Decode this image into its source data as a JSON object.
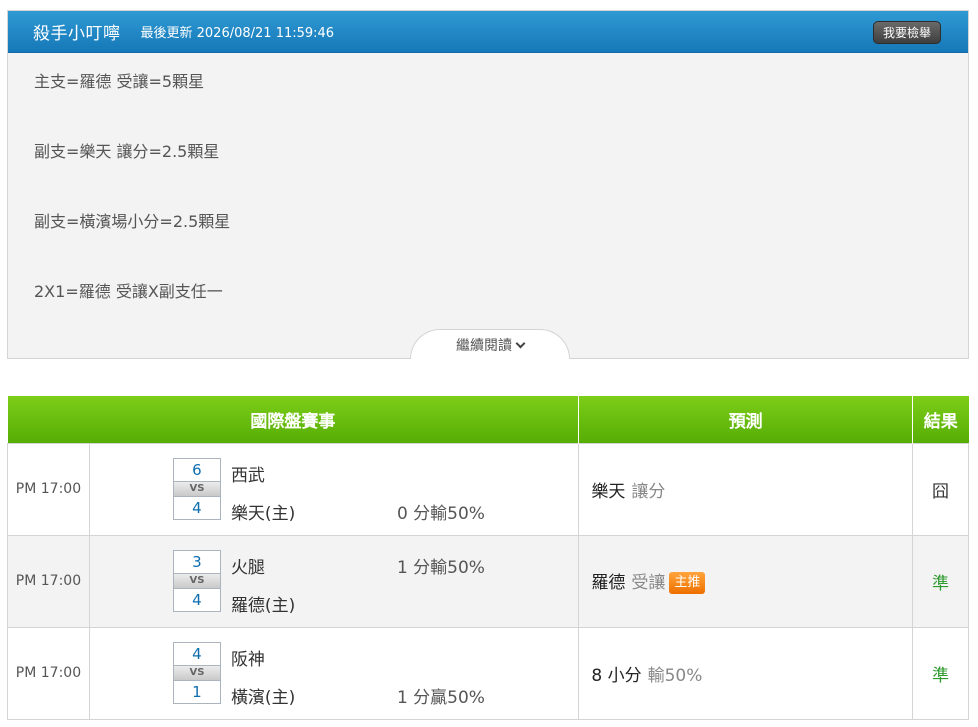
{
  "header": {
    "title": "殺手小叮嚀",
    "updated": "最後更新 2026/08/21 11:59:46",
    "report_label": "我要檢舉",
    "bg_color": "#1e86c6"
  },
  "picks": [
    "主支=羅德 受讓=5顆星",
    "副支=樂天 讓分=2.5顆星",
    "副支=橫濱場小分=2.5顆星",
    "2X1=羅德 受讓X副支任一"
  ],
  "more_label": "繼續閱讀",
  "table": {
    "header_color": "#66bb0e",
    "headers": {
      "match": "國際盤賽事",
      "predict": "預測",
      "result": "結果"
    },
    "rows": [
      {
        "time": "PM 17:00",
        "score_top": "6",
        "score_bottom": "4",
        "vs": "VS",
        "team_top": "西武",
        "team_bottom": "樂天(主)",
        "line_top": "",
        "line_bottom": "0 分輸50%",
        "pred_team": "樂天",
        "pred_type": "讓分",
        "badge": "",
        "result": "囧"
      },
      {
        "time": "PM 17:00",
        "score_top": "3",
        "score_bottom": "4",
        "vs": "VS",
        "team_top": "火腿",
        "team_bottom": "羅德(主)",
        "line_top": "1 分輸50%",
        "line_bottom": "",
        "pred_team": "羅德",
        "pred_type": "受讓",
        "badge": "主推",
        "result": "準"
      },
      {
        "time": "PM 17:00",
        "score_top": "4",
        "score_bottom": "1",
        "vs": "VS",
        "team_top": "阪神",
        "team_bottom": "橫濱(主)",
        "line_top": "",
        "line_bottom": "1 分贏50%",
        "pred_team": "8 小分",
        "pred_type": "輸50%",
        "badge": "",
        "result": "準"
      }
    ]
  }
}
